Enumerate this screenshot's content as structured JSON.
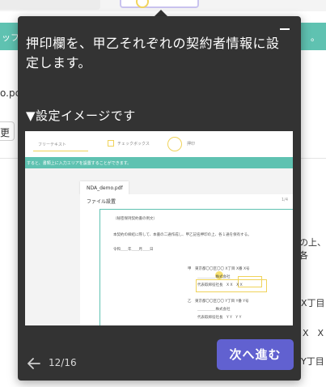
{
  "background": {
    "banner_left": "ッフ",
    "banner_right": "。",
    "filename": "o.pc",
    "edit_label": "更",
    "right_texts": [
      "の上、各",
      "X丁目",
      "X　X",
      "Y丁目"
    ]
  },
  "tooltip": {
    "title": "押印欄を、甲乙それぞれの契約者情報に設定します。",
    "section_label": "▼設定イメージです",
    "pager": "12/16",
    "next_label": "次へ進む"
  },
  "preview": {
    "tool_text": "フリーテキスト",
    "tool_checkbox": "チェックボックス",
    "tool_stamp": "押印",
    "banner": "すると、書類上に入力エリアを設置することができます。",
    "tab_label": "NDA_demo.pdf",
    "panel_title": "ファイル設置",
    "panel_page": "1/4",
    "doc_lines": [
      "（秘密保持契約書の例文）",
      "本契約の締結に際して、本書の二通作成し、甲乙記名押印の上、各１通を保有する。",
      "令和＿＿年＿＿月＿＿日",
      "甲　東京都〇〇区〇〇 X丁目 X番 X号",
      "＿＿＿＿＿株式会社",
      "代表取締役社長　X X　X X",
      "乙　東京都〇〇区〇〇 Y丁目 Y番 Y号",
      "＿＿＿＿＿株式会社",
      "代表取締役社長　Y Y　Y Y"
    ]
  }
}
